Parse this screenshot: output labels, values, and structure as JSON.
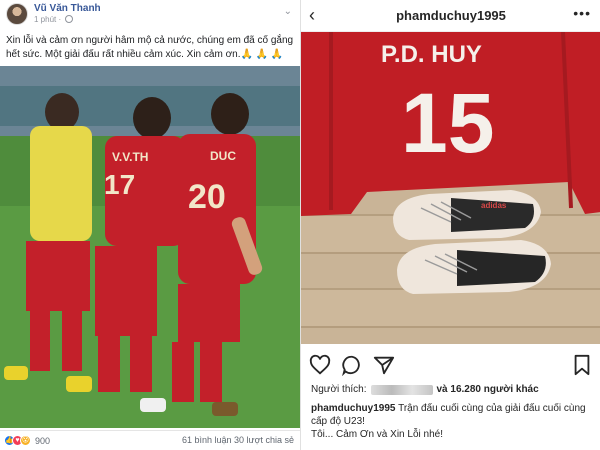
{
  "facebook": {
    "author": "Vũ Văn Thanh",
    "time": "1 phút · ",
    "menu": "⌄",
    "text": "Xin lỗi và cảm ơn người hâm mộ cả nước, chúng em đã cố gắng hết sức. Một giải đấu rất nhiều cảm xúc. Xin cảm ơn.🙏 🙏 🙏",
    "photo": {
      "jersey_left_name": "V.V.TH",
      "jersey_left_number": "17",
      "jersey_right_name": "DUC",
      "jersey_right_number": "20"
    },
    "reactions": {
      "like_icon": "👍",
      "love_icon": "♥",
      "wow_icon": "😮",
      "count": "900"
    },
    "stats": "61 bình luận   30 lượt chia sẻ"
  },
  "instagram": {
    "back": "‹",
    "username": "phamduchuy1995",
    "more": "•••",
    "photo": {
      "jersey_name": "P.D. HUY",
      "jersey_number": "15",
      "jersey_color": "#c01e25",
      "shoe_brand": "adidas"
    },
    "likes_prefix": "Người thích:",
    "likes_suffix": "và 16.280 người khác",
    "caption_user": "phamduchuy1995",
    "caption_line1": " Trận đấu cuối cùng của giải đấu cuối cùng cấp độ U23!",
    "caption_line2": "Tôi... Cảm Ơn và Xin Lỗi nhé!"
  }
}
